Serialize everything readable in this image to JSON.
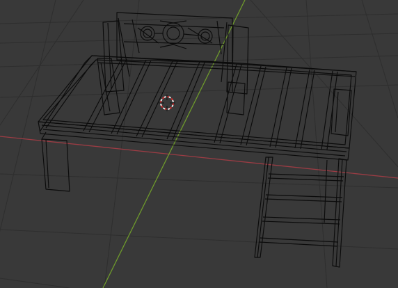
{
  "viewport": {
    "mode": "wireframe",
    "background_color": "#393939",
    "grid_color": "#2e2e2e",
    "wire_color": "#0b0b0b",
    "axis_x_color": "#9c3c44",
    "axis_y_color": "#6e9a2c",
    "cursor_colors": [
      "#e8e8e8",
      "#d23030"
    ],
    "objects": [
      "bed-platform",
      "headboard",
      "bed-legs",
      "ladder",
      "side-rail"
    ]
  }
}
